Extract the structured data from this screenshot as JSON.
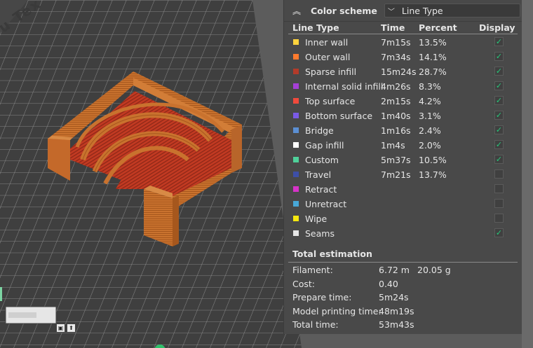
{
  "legend": {
    "title": "Color scheme",
    "scheme_value": "Line Type",
    "columns": {
      "type": "Line Type",
      "time": "Time",
      "percent": "Percent",
      "display": "Display"
    },
    "rows": [
      {
        "label": "Inner wall",
        "time": "7m15s",
        "percent": "13.5%",
        "color": "#ffd33d",
        "checked": true
      },
      {
        "label": "Outer wall",
        "time": "7m34s",
        "percent": "14.1%",
        "color": "#ff7b2e",
        "checked": true
      },
      {
        "label": "Sparse infill",
        "time": "15m24s",
        "percent": "28.7%",
        "color": "#b33b2a",
        "checked": true
      },
      {
        "label": "Internal solid infill",
        "time": "4m26s",
        "percent": "8.3%",
        "color": "#a53fd6",
        "checked": true
      },
      {
        "label": "Top surface",
        "time": "2m15s",
        "percent": "4.2%",
        "color": "#f04a3c",
        "checked": true
      },
      {
        "label": "Bottom surface",
        "time": "1m40s",
        "percent": "3.1%",
        "color": "#7a5ae6",
        "checked": true
      },
      {
        "label": "Bridge",
        "time": "1m16s",
        "percent": "2.4%",
        "color": "#5b8fd3",
        "checked": true
      },
      {
        "label": "Gap infill",
        "time": "1m4s",
        "percent": "2.0%",
        "color": "#ffffff",
        "checked": true
      },
      {
        "label": "Custom",
        "time": "5m37s",
        "percent": "10.5%",
        "color": "#4fd19a",
        "checked": true
      },
      {
        "label": "Travel",
        "time": "7m21s",
        "percent": "13.7%",
        "color": "#3d4fa8",
        "checked": false
      },
      {
        "label": "Retract",
        "time": "",
        "percent": "",
        "color": "#d633c8",
        "checked": false
      },
      {
        "label": "Unretract",
        "time": "",
        "percent": "",
        "color": "#48a8d8",
        "checked": false
      },
      {
        "label": "Wipe",
        "time": "",
        "percent": "",
        "color": "#f5e70f",
        "checked": false
      },
      {
        "label": "Seams",
        "time": "",
        "percent": "",
        "color": "#e6e6e6",
        "checked": true
      }
    ],
    "estimation": {
      "title": "Total estimation",
      "rows": [
        {
          "label": "Filament:",
          "v1": "6.72 m",
          "v2": "20.05 g"
        },
        {
          "label": "Cost:",
          "v1": "0.40",
          "v2": ""
        },
        {
          "label": "Prepare time:",
          "v1": "5m24s",
          "v2": ""
        },
        {
          "label": "Model printing time:",
          "v1": "48m19s",
          "v2": ""
        },
        {
          "label": "Total time:",
          "v1": "53m43s",
          "v2": ""
        }
      ]
    }
  },
  "viewport": {
    "bed_label": "u Tex"
  },
  "colors": {
    "check": "#26c97a",
    "panel": "#494949",
    "model": "#c9722e",
    "infill": "#c23a22"
  }
}
